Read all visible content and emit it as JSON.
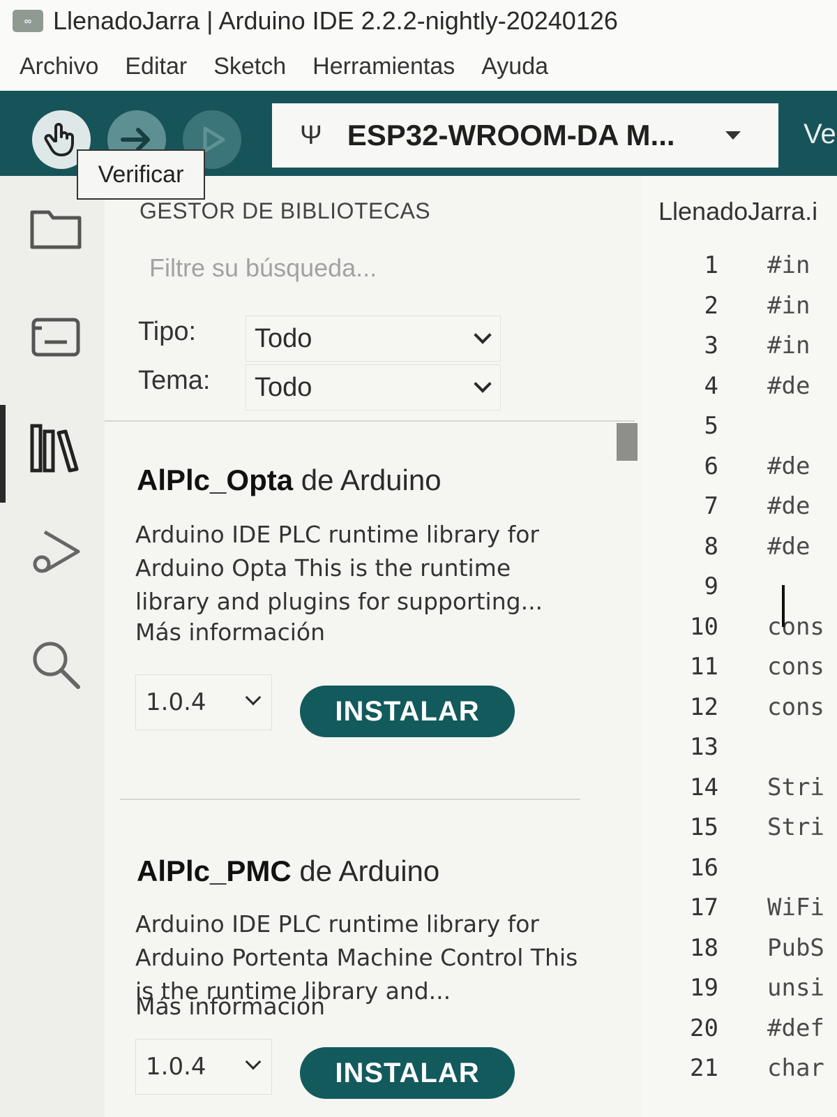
{
  "window": {
    "app_icon": "∞",
    "title": "LlenadoJarra | Arduino IDE 2.2.2-nightly-20240126"
  },
  "menu": [
    "Archivo",
    "Editar",
    "Sketch",
    "Herramientas",
    "Ayuda"
  ],
  "toolbar": {
    "verify_icon": "hand-pointer-icon",
    "upload_icon": "arrow-right-icon",
    "debug_icon": "debug-play-icon",
    "usb_icon": "usb-icon",
    "board": "ESP32-WROOM-DA M...",
    "right_partial": "Ve",
    "tooltip": "Verificar"
  },
  "sidebar": {
    "icons": [
      "folder-icon",
      "board-icon",
      "library-icon",
      "debug-icon",
      "search-icon"
    ],
    "active": "library-icon"
  },
  "library_manager": {
    "title": "GESTOR DE BIBLIOTECAS",
    "filter_placeholder": "Filtre su búsqueda...",
    "type_label": "Tipo:",
    "type_value": "Todo",
    "topic_label": "Tema:",
    "topic_value": "Todo",
    "libraries": [
      {
        "name": "AlPlc_Opta",
        "author": "de Arduino",
        "description": "Arduino IDE PLC runtime library for Arduino Opta This is the runtime library and plugins for supporting...",
        "more": "Más información",
        "version": "1.0.4",
        "install_label": "INSTALAR"
      },
      {
        "name": "AlPlc_PMC",
        "author": "de Arduino",
        "description": "Arduino IDE PLC runtime library for Arduino Portenta Machine Control This is the runtime library and...",
        "more": "Más información",
        "version": "1.0.4",
        "install_label": "INSTALAR"
      }
    ]
  },
  "editor": {
    "tab": "LlenadoJarra.i",
    "lines": [
      {
        "n": "1",
        "code": "#in"
      },
      {
        "n": "2",
        "code": "#in"
      },
      {
        "n": "3",
        "code": "#in"
      },
      {
        "n": "4",
        "code": "#de"
      },
      {
        "n": "5",
        "code": ""
      },
      {
        "n": "6",
        "code": "#de"
      },
      {
        "n": "7",
        "code": "#de"
      },
      {
        "n": "8",
        "code": "#de"
      },
      {
        "n": "9",
        "code": ""
      },
      {
        "n": "10",
        "code": "cons"
      },
      {
        "n": "11",
        "code": "cons"
      },
      {
        "n": "12",
        "code": "cons"
      },
      {
        "n": "13",
        "code": ""
      },
      {
        "n": "14",
        "code": "Stri"
      },
      {
        "n": "15",
        "code": "Stri"
      },
      {
        "n": "16",
        "code": ""
      },
      {
        "n": "17",
        "code": "WiFi"
      },
      {
        "n": "18",
        "code": "PubS"
      },
      {
        "n": "19",
        "code": "unsi"
      },
      {
        "n": "20",
        "code": "#def"
      },
      {
        "n": "21",
        "code": "char"
      }
    ]
  }
}
